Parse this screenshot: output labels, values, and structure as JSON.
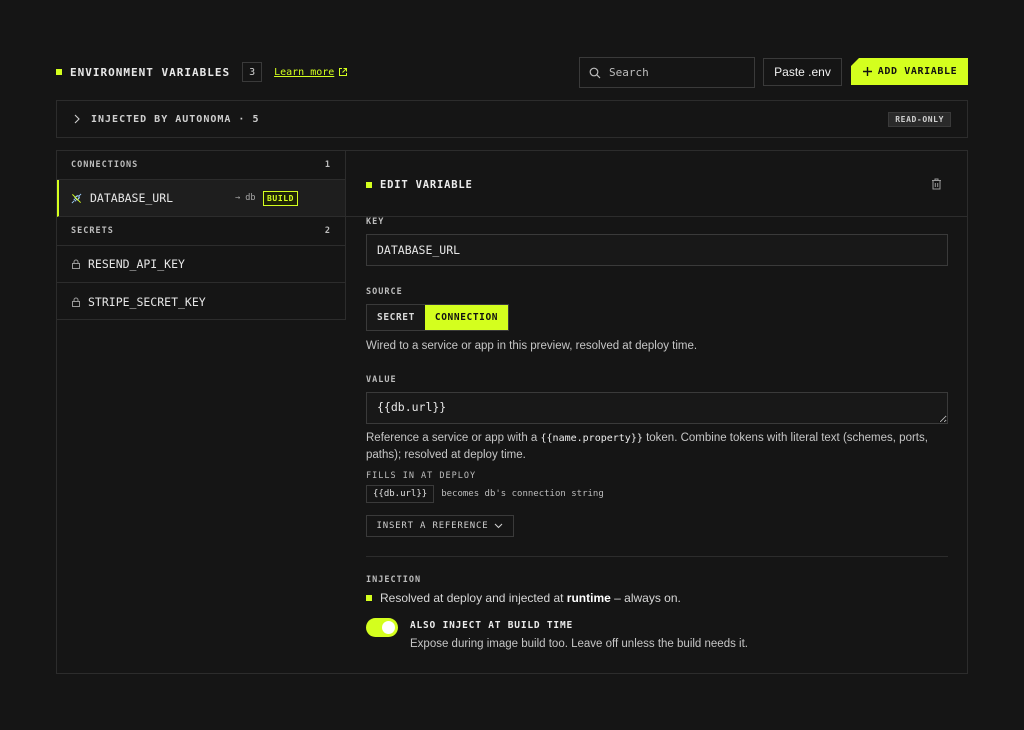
{
  "header": {
    "title": "ENVIRONMENT VARIABLES",
    "count": "3",
    "learn_more": "Learn more",
    "search_placeholder": "Search",
    "paste_label": "Paste .env",
    "add_label": "ADD VARIABLE"
  },
  "injected": {
    "label": "INJECTED BY AUTONOMA · 5",
    "badge": "READ-ONLY"
  },
  "sidebar": {
    "connections_title": "CONNECTIONS",
    "connections_count": "1",
    "connections": [
      {
        "name": "DATABASE_URL",
        "target": "→ db",
        "badge": "BUILD"
      }
    ],
    "secrets_title": "SECRETS",
    "secrets_count": "2",
    "secrets": [
      {
        "name": "RESEND_API_KEY"
      },
      {
        "name": "STRIPE_SECRET_KEY"
      }
    ]
  },
  "editor": {
    "title": "EDIT VARIABLE",
    "key_label": "KEY",
    "key_value": "DATABASE_URL",
    "source_label": "SOURCE",
    "source_options": [
      "SECRET",
      "CONNECTION"
    ],
    "source_selected": "CONNECTION",
    "source_help": "Wired to a service or app in this preview, resolved at deploy time.",
    "value_label": "VALUE",
    "value": "{{db.url}}",
    "value_help_pre": "Reference a service or app with a ",
    "value_help_code": "{{name.property}}",
    "value_help_post": " token. Combine tokens with literal text (schemes, ports, paths); resolved at deploy time.",
    "fills_label": "FILLS IN AT DEPLOY",
    "fills_token": "{{db.url}}",
    "fills_text": "becomes db's connection string",
    "insert_label": "INSERT A REFERENCE",
    "injection_label": "INJECTION",
    "injection_pre": "Resolved at deploy and injected at ",
    "injection_bold": "runtime",
    "injection_post": " – always on.",
    "toggle_on": true,
    "toggle_title": "ALSO INJECT AT BUILD TIME",
    "toggle_desc": "Expose during image build too. Leave off unless the build needs it."
  },
  "colors": {
    "accent": "#d4ff1e",
    "background": "#151515",
    "border": "#2c2c2c"
  },
  "icons": [
    "search-icon",
    "external-link-icon",
    "plus-icon",
    "chevron-right-icon",
    "plug-icon",
    "lock-icon",
    "trash-icon",
    "chevron-down-icon"
  ]
}
